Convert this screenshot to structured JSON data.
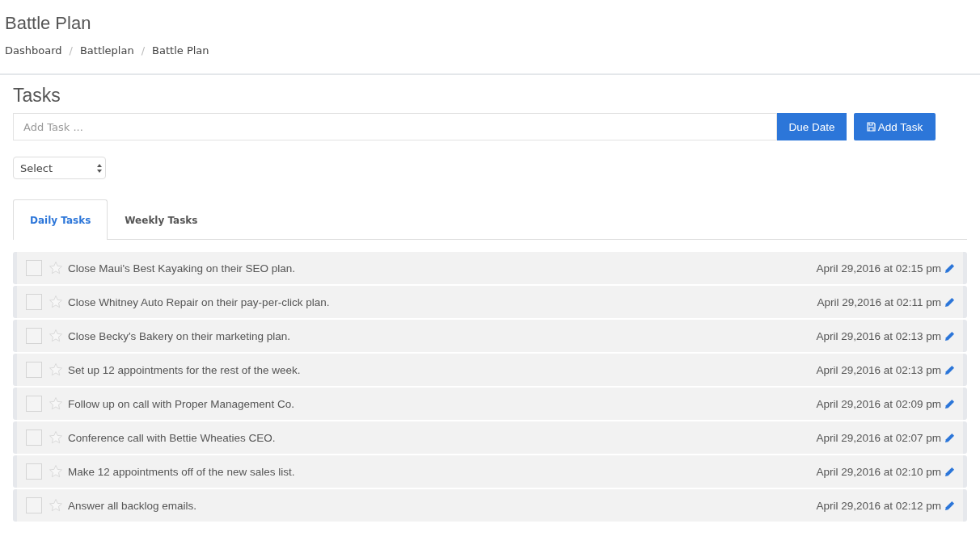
{
  "page": {
    "title": "Battle Plan"
  },
  "breadcrumb": [
    "Dashboard",
    "Battleplan",
    "Battle Plan"
  ],
  "breadcrumb_separator": "/",
  "section_title": "Tasks",
  "add_task": {
    "placeholder": "Add Task ...",
    "due_date_button": "Due Date",
    "add_button": "Add Task"
  },
  "select": {
    "value": "Select"
  },
  "tabs": [
    {
      "label": "Daily Tasks",
      "selected": true
    },
    {
      "label": "Weekly Tasks",
      "selected": false
    }
  ],
  "tasks": [
    {
      "text": "Close Maui's Best Kayaking on their SEO plan.",
      "date": "April 29,2016 at 02:15 pm",
      "checked": false,
      "starred": false
    },
    {
      "text": "Close Whitney Auto Repair on their pay-per-click plan.",
      "date": "April 29,2016 at 02:11 pm",
      "checked": false,
      "starred": false
    },
    {
      "text": "Close Becky's Bakery on their marketing plan.",
      "date": "April 29,2016 at 02:13 pm",
      "checked": false,
      "starred": false
    },
    {
      "text": "Set up 12 appointments for the rest of the week.",
      "date": "April 29,2016 at 02:13 pm",
      "checked": false,
      "starred": false
    },
    {
      "text": "Follow up on call with Proper Management Co.",
      "date": "April 29,2016 at 02:09 pm",
      "checked": false,
      "starred": false
    },
    {
      "text": "Conference call with Bettie Wheaties CEO.",
      "date": "April 29,2016 at 02:07 pm",
      "checked": false,
      "starred": false
    },
    {
      "text": "Make 12 appointments off of the new sales list.",
      "date": "April 29,2016 at 02:10 pm",
      "checked": false,
      "starred": false
    },
    {
      "text": "Answer all backlog emails.",
      "date": "April 29,2016 at 02:12 pm",
      "checked": false,
      "starred": false
    }
  ]
}
